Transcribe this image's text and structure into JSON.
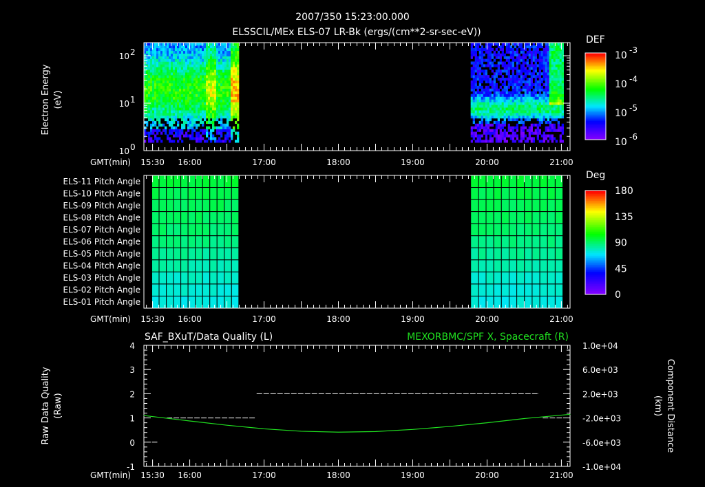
{
  "header": {
    "timestamp": "2007/350 15:23:00.000",
    "title": "ELSSCIL/MEx ELS-07 LR-Bk  (ergs/(cm**2-sr-sec-eV))"
  },
  "time_axis": {
    "label": "GMT(min)",
    "ticks": [
      "15:30",
      "16:00",
      "17:00",
      "18:00",
      "19:00",
      "20:00",
      "21:00"
    ],
    "tick_hours": [
      15.5,
      16,
      17,
      18,
      19,
      20,
      21
    ],
    "range_hours": [
      15.3833,
      21.1167
    ]
  },
  "chart_data": [
    {
      "type": "heatmap",
      "title": "ELSSCIL/MEx ELS-07 LR-Bk  (ergs/(cm**2-sr-sec-eV))",
      "ylabel": "Electron Energy",
      "ylabel_units": "(eV)",
      "yscale": "log",
      "ylim": [
        1,
        160
      ],
      "yticks": [
        {
          "base": "10",
          "exp": "0",
          "value": 1
        },
        {
          "base": "10",
          "exp": "1",
          "value": 10
        },
        {
          "base": "10",
          "exp": "2",
          "value": 100
        }
      ],
      "data_intervals_hours": [
        [
          15.3833,
          16.65
        ],
        [
          19.78,
          21.02
        ]
      ],
      "colorbar": {
        "label": "DEF",
        "scale": "log",
        "range": [
          1e-06,
          0.001
        ],
        "ticks": [
          {
            "base": "10",
            "exp": "-3"
          },
          {
            "base": "10",
            "exp": "-4"
          },
          {
            "base": "10",
            "exp": "-5"
          },
          {
            "base": "10",
            "exp": "-6"
          }
        ]
      }
    },
    {
      "type": "heatmap",
      "rows": [
        "ELS-11 Pitch Angle",
        "ELS-10 Pitch Angle",
        "ELS-09 Pitch Angle",
        "ELS-08 Pitch Angle",
        "ELS-07 Pitch Angle",
        "ELS-06 Pitch Angle",
        "ELS-05 Pitch Angle",
        "ELS-04 Pitch Angle",
        "ELS-03 Pitch Angle",
        "ELS-02 Pitch Angle",
        "ELS-01 Pitch Angle"
      ],
      "row_values_deg": [
        100,
        96,
        94,
        92,
        90,
        86,
        82,
        78,
        72,
        70,
        68
      ],
      "data_intervals_hours": [
        [
          15.49,
          16.66
        ],
        [
          19.78,
          21.02
        ]
      ],
      "colorbar": {
        "label": "Deg",
        "range": [
          0,
          180
        ],
        "ticks": [
          "180",
          "135",
          "90",
          "45",
          "0"
        ]
      }
    },
    {
      "type": "line",
      "left_title": "SAF_BXuT/Data Quality (L)",
      "right_title": "MEXORBMC/SPF X, Spacecraft (R)",
      "ylabel_left": "Raw  Data  Quality",
      "ylabel_left_units": "(Raw)",
      "ylabel_right": "Component  Distance",
      "ylabel_right_units": "(km)",
      "ylim_left": [
        -1,
        4
      ],
      "yticks_left": [
        "4",
        "3",
        "2",
        "1",
        "0",
        "-1"
      ],
      "ylim_right": [
        -10000,
        10000
      ],
      "yticks_right": [
        "1.0e+04",
        "6.0e+03",
        "2.0e+03",
        "-2.0e+03",
        "-6.0e+03",
        "-1.0e+04"
      ],
      "series": [
        {
          "name": "Data Quality",
          "axis": "left",
          "color": "#ffffff",
          "segments": [
            {
              "x": [
                15.49,
                15.57
              ],
              "y": 0
            },
            {
              "x": [
                15.69,
                16.88
              ],
              "y": 1
            },
            {
              "x": [
                16.9,
                20.7
              ],
              "y": 2
            },
            {
              "x": [
                20.75,
                21.02
              ],
              "y": 1
            }
          ]
        },
        {
          "name": "MEXORBMC/SPF X, Spacecraft",
          "axis": "right",
          "color": "#20e020",
          "x": [
            15.38,
            16.0,
            16.5,
            17.0,
            17.5,
            18.0,
            18.5,
            19.0,
            19.5,
            20.0,
            20.5,
            21.12
          ],
          "y": [
            -1600,
            -2500,
            -3200,
            -3800,
            -4200,
            -4350,
            -4250,
            -3900,
            -3400,
            -2800,
            -2100,
            -1400
          ]
        }
      ]
    }
  ],
  "colors": {
    "green": "#20e020",
    "background": "#000000",
    "axes": "#ffffff"
  }
}
